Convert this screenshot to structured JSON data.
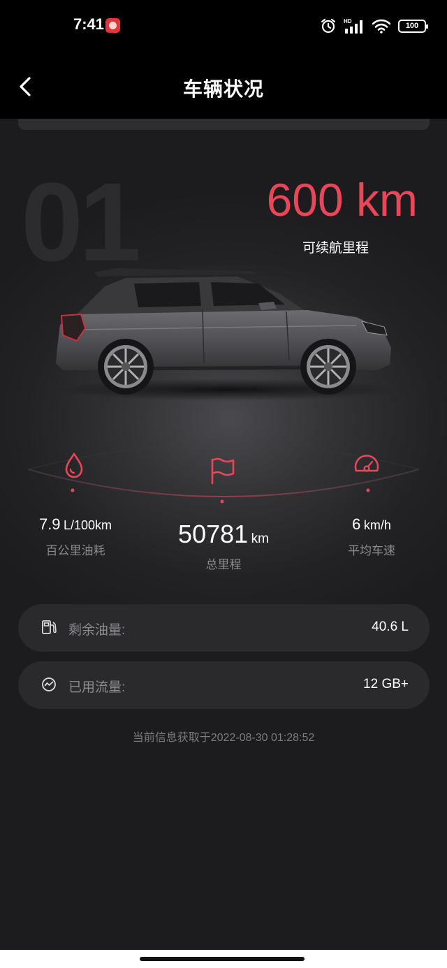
{
  "status_bar": {
    "time": "7:41",
    "hd_label": "HD",
    "battery": "100"
  },
  "header": {
    "title": "车辆状况"
  },
  "hero": {
    "background_number": "01",
    "range_value": "600 km",
    "range_label": "可续航里程"
  },
  "stats": {
    "fuel_consumption": {
      "value": "7.9",
      "unit": "L/100km",
      "label": "百公里油耗",
      "icon": "droplet-icon"
    },
    "total_mileage": {
      "value": "50781",
      "unit": "km",
      "label": "总里程",
      "icon": "flag-icon"
    },
    "average_speed": {
      "value": "6",
      "unit": "km/h",
      "label": "平均车速",
      "icon": "speedometer-icon"
    }
  },
  "info": {
    "fuel_remaining": {
      "label": "剩余油量:",
      "value": "40.6 L",
      "icon": "fuel-pump-icon"
    },
    "data_used": {
      "label": "已用流量:",
      "value": "12 GB+",
      "icon": "traffic-icon"
    }
  },
  "footer": {
    "timestamp": "当前信息获取于2022-08-30 01:28:52"
  },
  "colors": {
    "accent": "#e8475a",
    "background": "#1c1c1e",
    "card": "#2a2a2d",
    "muted_text": "#8b8b90"
  }
}
